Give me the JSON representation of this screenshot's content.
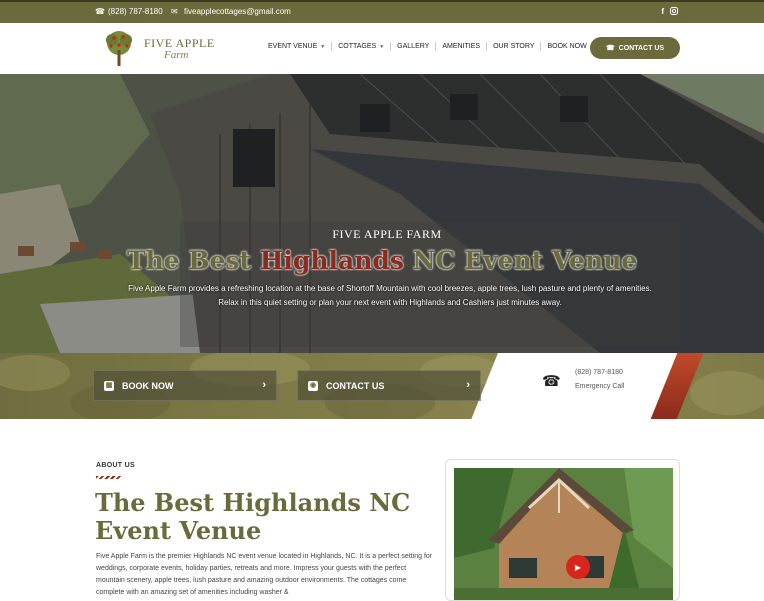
{
  "topbar": {
    "phone": "(828) 787-8180",
    "email": "fiveapplecottages@gmail.com",
    "social": [
      "facebook-icon",
      "instagram-icon"
    ]
  },
  "header": {
    "logo_brand": "FIVE APPLE",
    "logo_sub": "Farm",
    "nav": [
      {
        "label": "EVENT VENUE",
        "dropdown": true
      },
      {
        "label": "COTTAGES",
        "dropdown": true
      },
      {
        "label": "GALLERY",
        "dropdown": false
      },
      {
        "label": "AMENITIES",
        "dropdown": false
      },
      {
        "label": "OUR STORY",
        "dropdown": false
      },
      {
        "label": "BOOK NOW",
        "dropdown": false
      }
    ],
    "contact_label": "CONTACT US"
  },
  "hero": {
    "kicker": "FIVE APPLE FARM",
    "title_pre": "The Best ",
    "title_highlight": "Highlands",
    "title_post": " NC Event Venue",
    "desc_line1": "Five Apple Farm provides a refreshing location at the base of Shortoff Mountain with cool breezes, apple trees, lush pasture and plenty of amenities.",
    "desc_line2": "Relax in this quiet setting or plan your next event with Highlands and Cashiers just minutes away."
  },
  "cta": {
    "book_label": "BOOK NOW",
    "contact_label": "CONTACT US",
    "emergency_phone": "(828) 787-8180",
    "emergency_label": "Emergency Call"
  },
  "about": {
    "label": "ABOUT US",
    "title": "The Best Highlands NC Event Venue",
    "text": "Five Apple Farm is the premier Highlands NC event venue located in Highlands, NC. It is a perfect setting for weddings, corporate events, holiday parties, retreats and more. Impress your guests with the perfect mountain scenery, apple trees, lush pasture and amazing outdoor environments. The cottages come complete with an amazing set of amenities including washer &"
  },
  "colors": {
    "olive": "#6b6a3c",
    "red": "#8b2a1d",
    "youtube": "#d8261c"
  }
}
